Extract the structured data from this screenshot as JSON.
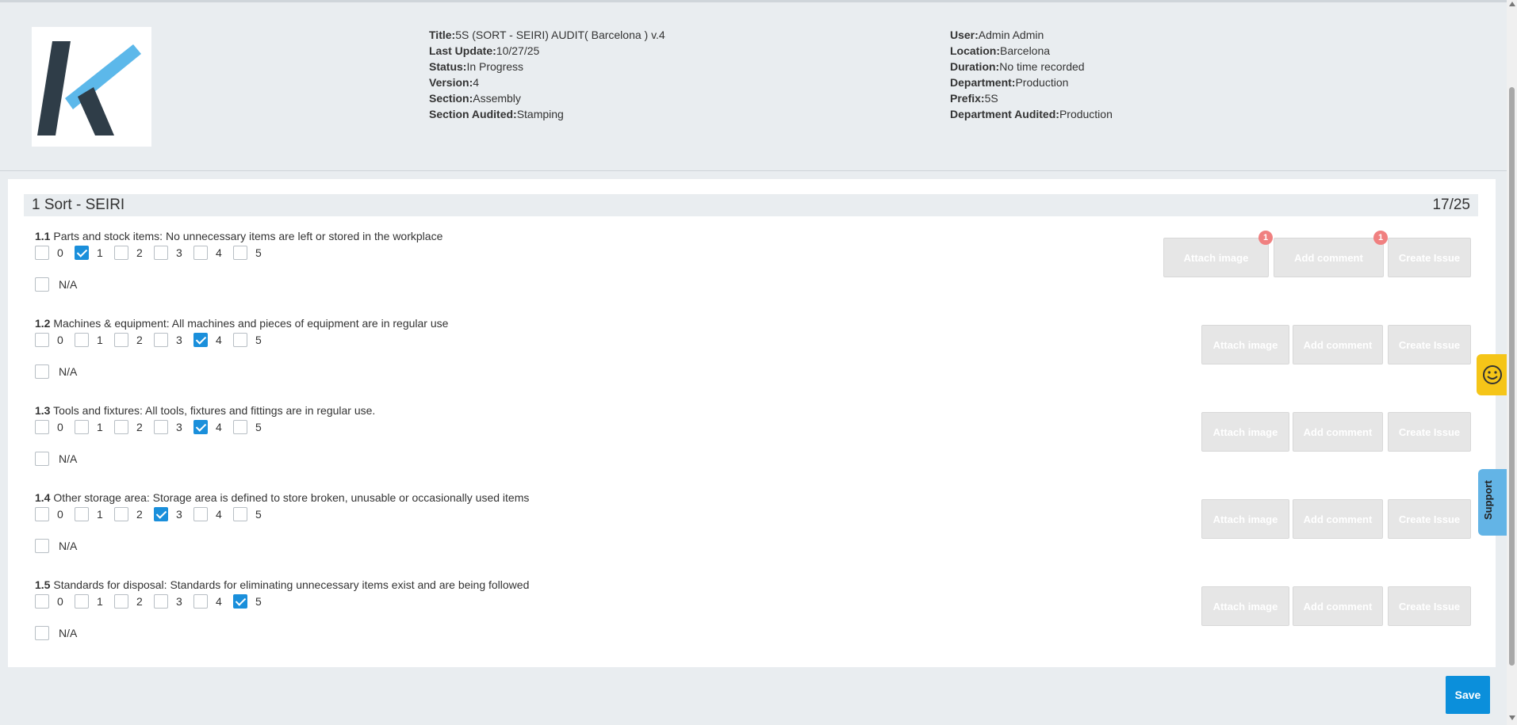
{
  "header": {
    "left": [
      {
        "label": "Title:",
        "value": "5S (SORT - SEIRI) AUDIT( Barcelona ) v.4"
      },
      {
        "label": "Last Update:",
        "value": "10/27/25"
      },
      {
        "label": "Status:",
        "value": "In Progress"
      },
      {
        "label": "Version:",
        "value": "4"
      },
      {
        "label": "Section:",
        "value": "Assembly"
      },
      {
        "label": "Section Audited:",
        "value": "Stamping"
      }
    ],
    "right": [
      {
        "label": "User:",
        "value": "Admin Admin"
      },
      {
        "label": "Location:",
        "value": "Barcelona"
      },
      {
        "label": "Duration:",
        "value": "No time recorded"
      },
      {
        "label": "Department:",
        "value": "Production"
      },
      {
        "label": "Prefix:",
        "value": "5S"
      },
      {
        "label": "Department Audited:",
        "value": "Production"
      }
    ]
  },
  "section": {
    "title": "1 Sort - SEIRI",
    "score": "17/25"
  },
  "options": [
    "0",
    "1",
    "2",
    "3",
    "4",
    "5"
  ],
  "na_label": "N/A",
  "buttons": {
    "attach": "Attach image",
    "comment": "Add comment",
    "issue": "Create Issue",
    "save": "Save"
  },
  "questions": [
    {
      "num": "1.1",
      "text": " Parts and stock items: No unnecessary items are left or stored in the workplace",
      "selected": 1,
      "attach_badge": "1",
      "comment_badge": "1"
    },
    {
      "num": "1.2",
      "text": " Machines & equipment: All machines and pieces of equipment are in regular use",
      "selected": 4
    },
    {
      "num": "1.3",
      "text": " Tools and fixtures: All tools, fixtures and fittings are in regular use.",
      "selected": 4
    },
    {
      "num": "1.4",
      "text": " Other storage area: Storage area is defined to store broken, unusable or occasionally used items",
      "selected": 3
    },
    {
      "num": "1.5",
      "text": " Standards for disposal: Standards for eliminating unnecessary items exist and are being followed",
      "selected": 5
    }
  ],
  "support_label": "Support",
  "colors": {
    "accent": "#0b8fdb",
    "checkbox_checked": "#1a8fdb",
    "badge": "#f08080",
    "feedback": "#f5c518",
    "support": "#63b4e6"
  }
}
